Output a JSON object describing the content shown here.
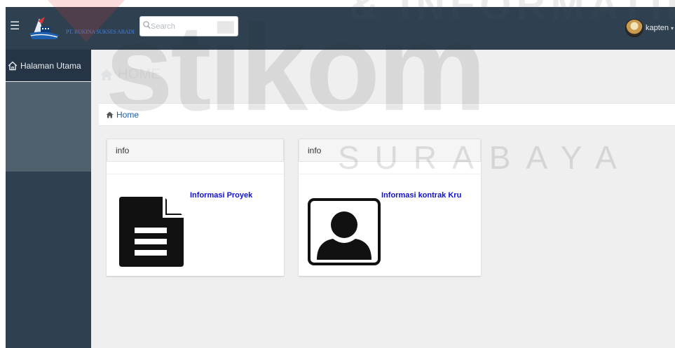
{
  "topbar": {
    "menu_icon": "hamburger-icon",
    "logo_text": "PT. RUKINA SUKSES ABADI",
    "search_placeholder": "Search",
    "user_name": "kapten",
    "caret_glyph": "▾"
  },
  "sidebar": {
    "items": [
      {
        "label": "Halaman Utama",
        "icon": "home-icon"
      }
    ]
  },
  "main": {
    "page_title": "HOME",
    "breadcrumb": {
      "label": "Home",
      "icon": "home-icon"
    },
    "cards": [
      {
        "header": "info",
        "link": "Informasi Proyek",
        "icon": "document-icon"
      },
      {
        "header": "info",
        "link": "Informasi kontrak Kru",
        "icon": "user-profile-icon"
      }
    ]
  },
  "watermark": {
    "main": "stikom",
    "top": "& INFORMATIKA",
    "sub": "SURABAYA"
  },
  "colors": {
    "sidebar": "#2f4050",
    "sidebar_band": "#51606d",
    "content_bg": "#efefef",
    "link": "#1010d0",
    "breadcrumb_link": "#1f5ea8"
  }
}
